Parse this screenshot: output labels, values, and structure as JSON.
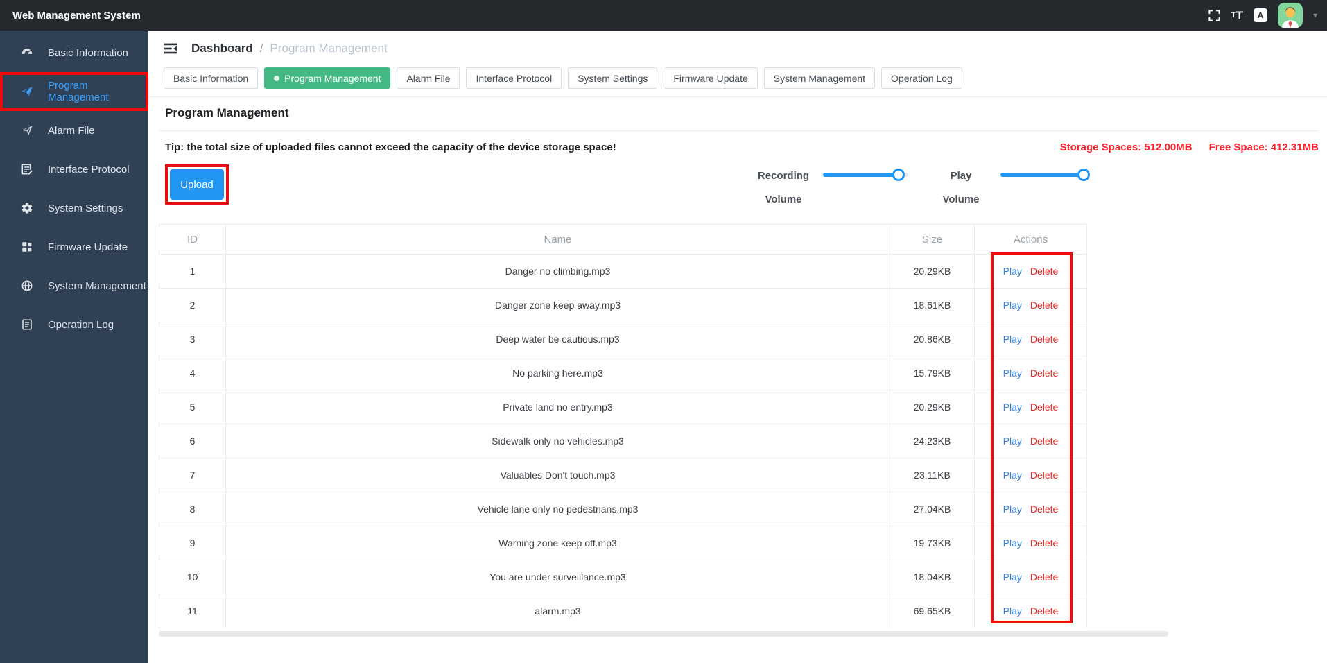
{
  "colors": {
    "topbar-bg": "#25282c",
    "sidebar-bg": "#304156",
    "active-blue": "#3ca2ff",
    "accent-blue": "#2196f3",
    "tab-green": "#42b983",
    "annotation-red": "#ee0b0b",
    "status-red": "#f5222d",
    "link-blue": "#3584e4",
    "delete-red": "#f02626"
  },
  "header": {
    "title": "Web Management System"
  },
  "sidebar": {
    "items": [
      {
        "label": "Basic Information"
      },
      {
        "label": "Program Management"
      },
      {
        "label": "Alarm File"
      },
      {
        "label": "Interface Protocol"
      },
      {
        "label": "System Settings"
      },
      {
        "label": "Firmware Update"
      },
      {
        "label": "System Management"
      },
      {
        "label": "Operation Log"
      }
    ]
  },
  "breadcrumb": {
    "root": "Dashboard",
    "separator": "/",
    "current": "Program Management"
  },
  "tabs": [
    {
      "label": "Basic Information"
    },
    {
      "label": "Program Management"
    },
    {
      "label": "Alarm File"
    },
    {
      "label": "Interface Protocol"
    },
    {
      "label": "System Settings"
    },
    {
      "label": "Firmware Update"
    },
    {
      "label": "System Management"
    },
    {
      "label": "Operation Log"
    }
  ],
  "page": {
    "title": "Program Management",
    "tip": "Tip: the total size of uploaded files cannot exceed the capacity of the device storage space!",
    "storage_spaces": "Storage Spaces: 512.00MB",
    "free_space": "Free Space: 412.31MB"
  },
  "controls": {
    "upload_label": "Upload",
    "recording_volume": {
      "label_line1": "Recording",
      "label_line2": "Volume",
      "percent": 88
    },
    "play_volume": {
      "label_line1": "Play",
      "label_line2": "Volume",
      "percent": 97
    }
  },
  "table": {
    "headers": [
      "ID",
      "Name",
      "Size",
      "Actions"
    ],
    "play_label": "Play",
    "delete_label": "Delete",
    "rows": [
      {
        "id": "1",
        "name": "Danger no climbing.mp3",
        "size": "20.29KB"
      },
      {
        "id": "2",
        "name": "Danger zone keep away.mp3",
        "size": "18.61KB"
      },
      {
        "id": "3",
        "name": "Deep water be cautious.mp3",
        "size": "20.86KB"
      },
      {
        "id": "4",
        "name": "No parking here.mp3",
        "size": "15.79KB"
      },
      {
        "id": "5",
        "name": "Private land no entry.mp3",
        "size": "20.29KB"
      },
      {
        "id": "6",
        "name": "Sidewalk only no vehicles.mp3",
        "size": "24.23KB"
      },
      {
        "id": "7",
        "name": "Valuables Don't touch.mp3",
        "size": "23.11KB"
      },
      {
        "id": "8",
        "name": "Vehicle lane only no pedestrians.mp3",
        "size": "27.04KB"
      },
      {
        "id": "9",
        "name": "Warning zone keep off.mp3",
        "size": "19.73KB"
      },
      {
        "id": "10",
        "name": "You are under surveillance.mp3",
        "size": "18.04KB"
      },
      {
        "id": "11",
        "name": "alarm.mp3",
        "size": "69.65KB"
      }
    ]
  }
}
